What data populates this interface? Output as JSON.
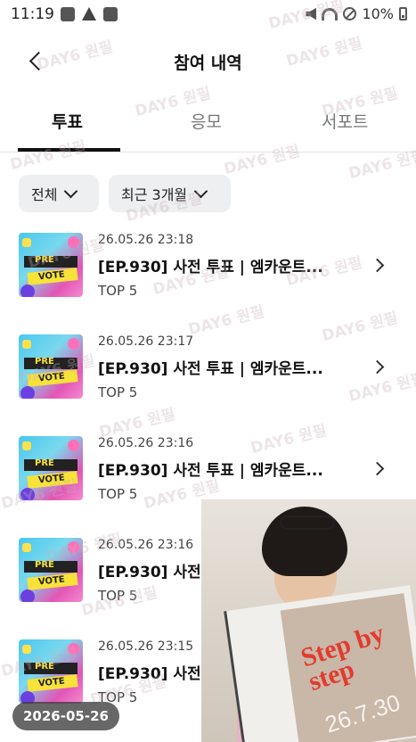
{
  "status_bar": {
    "time": "11:19",
    "battery_text": "10%"
  },
  "header": {
    "title": "참여 내역"
  },
  "tabs": [
    {
      "label": "투표",
      "active": true
    },
    {
      "label": "응모",
      "active": false
    },
    {
      "label": "서포트",
      "active": false
    }
  ],
  "filters": [
    {
      "label": "전체"
    },
    {
      "label": "최근 3개월"
    }
  ],
  "items": [
    {
      "date": "26.05.26 23:18",
      "title": "[EP.930] 사전 투표 | 엠카운트...",
      "rank": "TOP 5",
      "thumb_top": "PRE",
      "thumb_bottom": "VOTE"
    },
    {
      "date": "26.05.26 23:17",
      "title": "[EP.930] 사전 투표 | 엠카운트...",
      "rank": "TOP 5",
      "thumb_top": "PRE",
      "thumb_bottom": "VOTE"
    },
    {
      "date": "26.05.26 23:16",
      "title": "[EP.930] 사전 투표 | 엠카운트...",
      "rank": "TOP 5",
      "thumb_top": "PRE",
      "thumb_bottom": "VOTE"
    },
    {
      "date": "26.05.26 23:16",
      "title": "[EP.930] 사전",
      "rank": "TOP 5",
      "thumb_top": "PRE",
      "thumb_bottom": "VOTE"
    },
    {
      "date": "26.05.26 23:15",
      "title": "[EP.930] 사전",
      "rank": "TOP 5",
      "thumb_top": "PRE",
      "thumb_bottom": "VOTE"
    }
  ],
  "video_overlay": {
    "magazine_text": "Step by step",
    "magazine_number": "26.7.30"
  },
  "date_badge": "2026-05-26",
  "watermark": "DAY6 원필",
  "colors": {
    "tab_active": "#111111",
    "filter_bg": "#eeeff1",
    "badge_bg": "#3c3c3c"
  }
}
